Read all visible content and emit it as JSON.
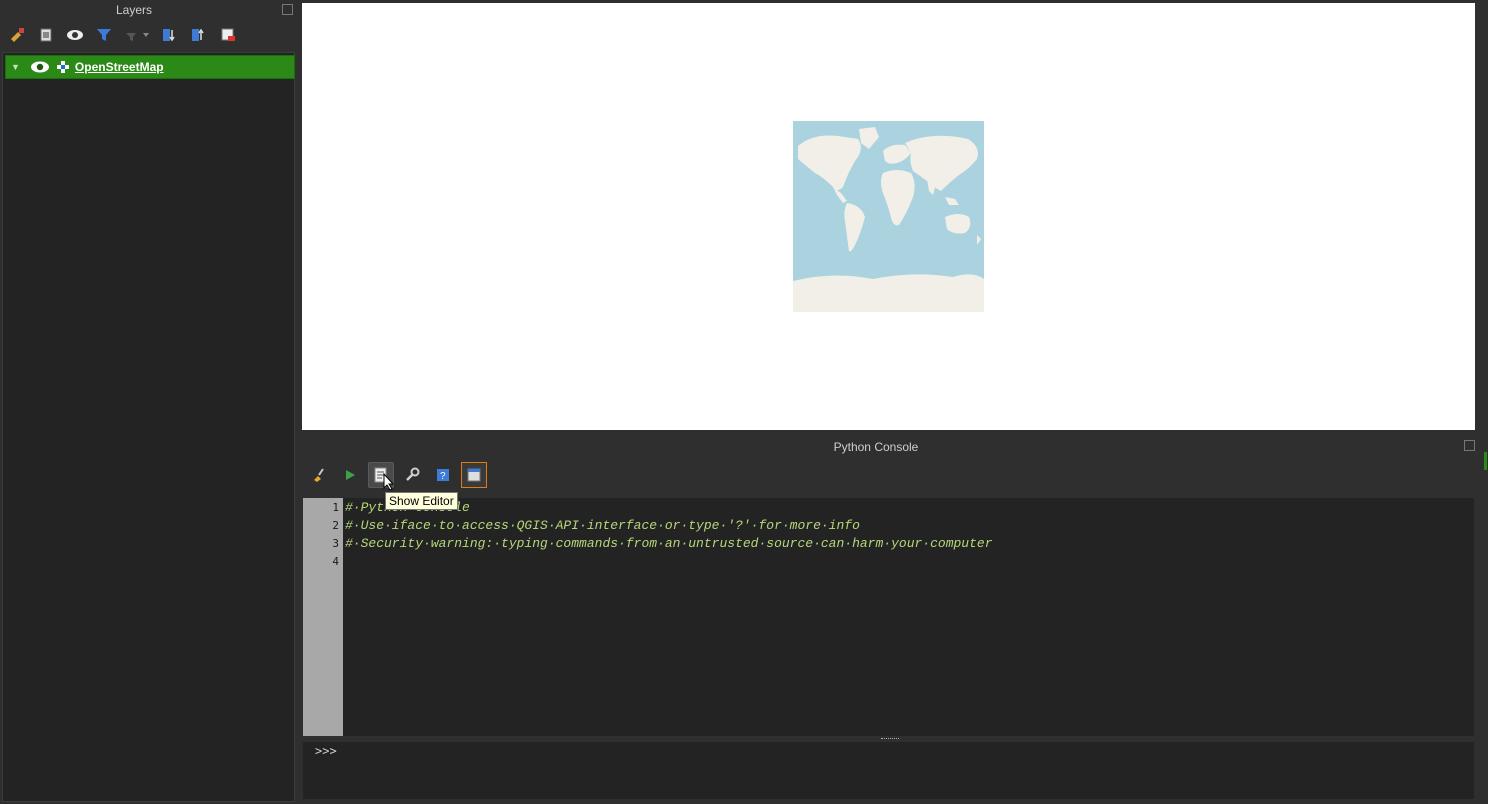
{
  "layers_panel": {
    "title": "Layers",
    "toolbar_icons": [
      "style-manager-icon",
      "add-group-icon",
      "visibility-icon",
      "filter-icon",
      "filter-expression-icon",
      "expand-all-icon",
      "collapse-all-icon",
      "remove-layer-icon"
    ],
    "layers": [
      {
        "name": "OpenStreetMap",
        "visible": true,
        "selected": true
      }
    ]
  },
  "map_canvas": {},
  "python_console": {
    "title": "Python Console",
    "toolbar_icons": [
      "clear-console-icon",
      "run-command-icon",
      "show-editor-icon",
      "options-icon",
      "help-icon",
      "dock-icon"
    ],
    "editor_lines": [
      {
        "num": "1",
        "text": "#·Python·Console"
      },
      {
        "num": "2",
        "text": "#·Use·iface·to·access·QGIS·API·interface·or·type·'?'·for·more·info"
      },
      {
        "num": "3",
        "text": "#·Security·warning:·typing·commands·from·an·untrusted·source·can·harm·your·computer"
      },
      {
        "num": "4",
        "text": ""
      }
    ],
    "prompt": ">>>"
  },
  "tooltip": {
    "text": "Show Editor"
  },
  "colors": {
    "selected_layer": "#2b8a17",
    "code_comment": "#b5d77a",
    "active_button_border": "#e07b1a",
    "ocean": "#aad3df",
    "land": "#f2efe9"
  }
}
